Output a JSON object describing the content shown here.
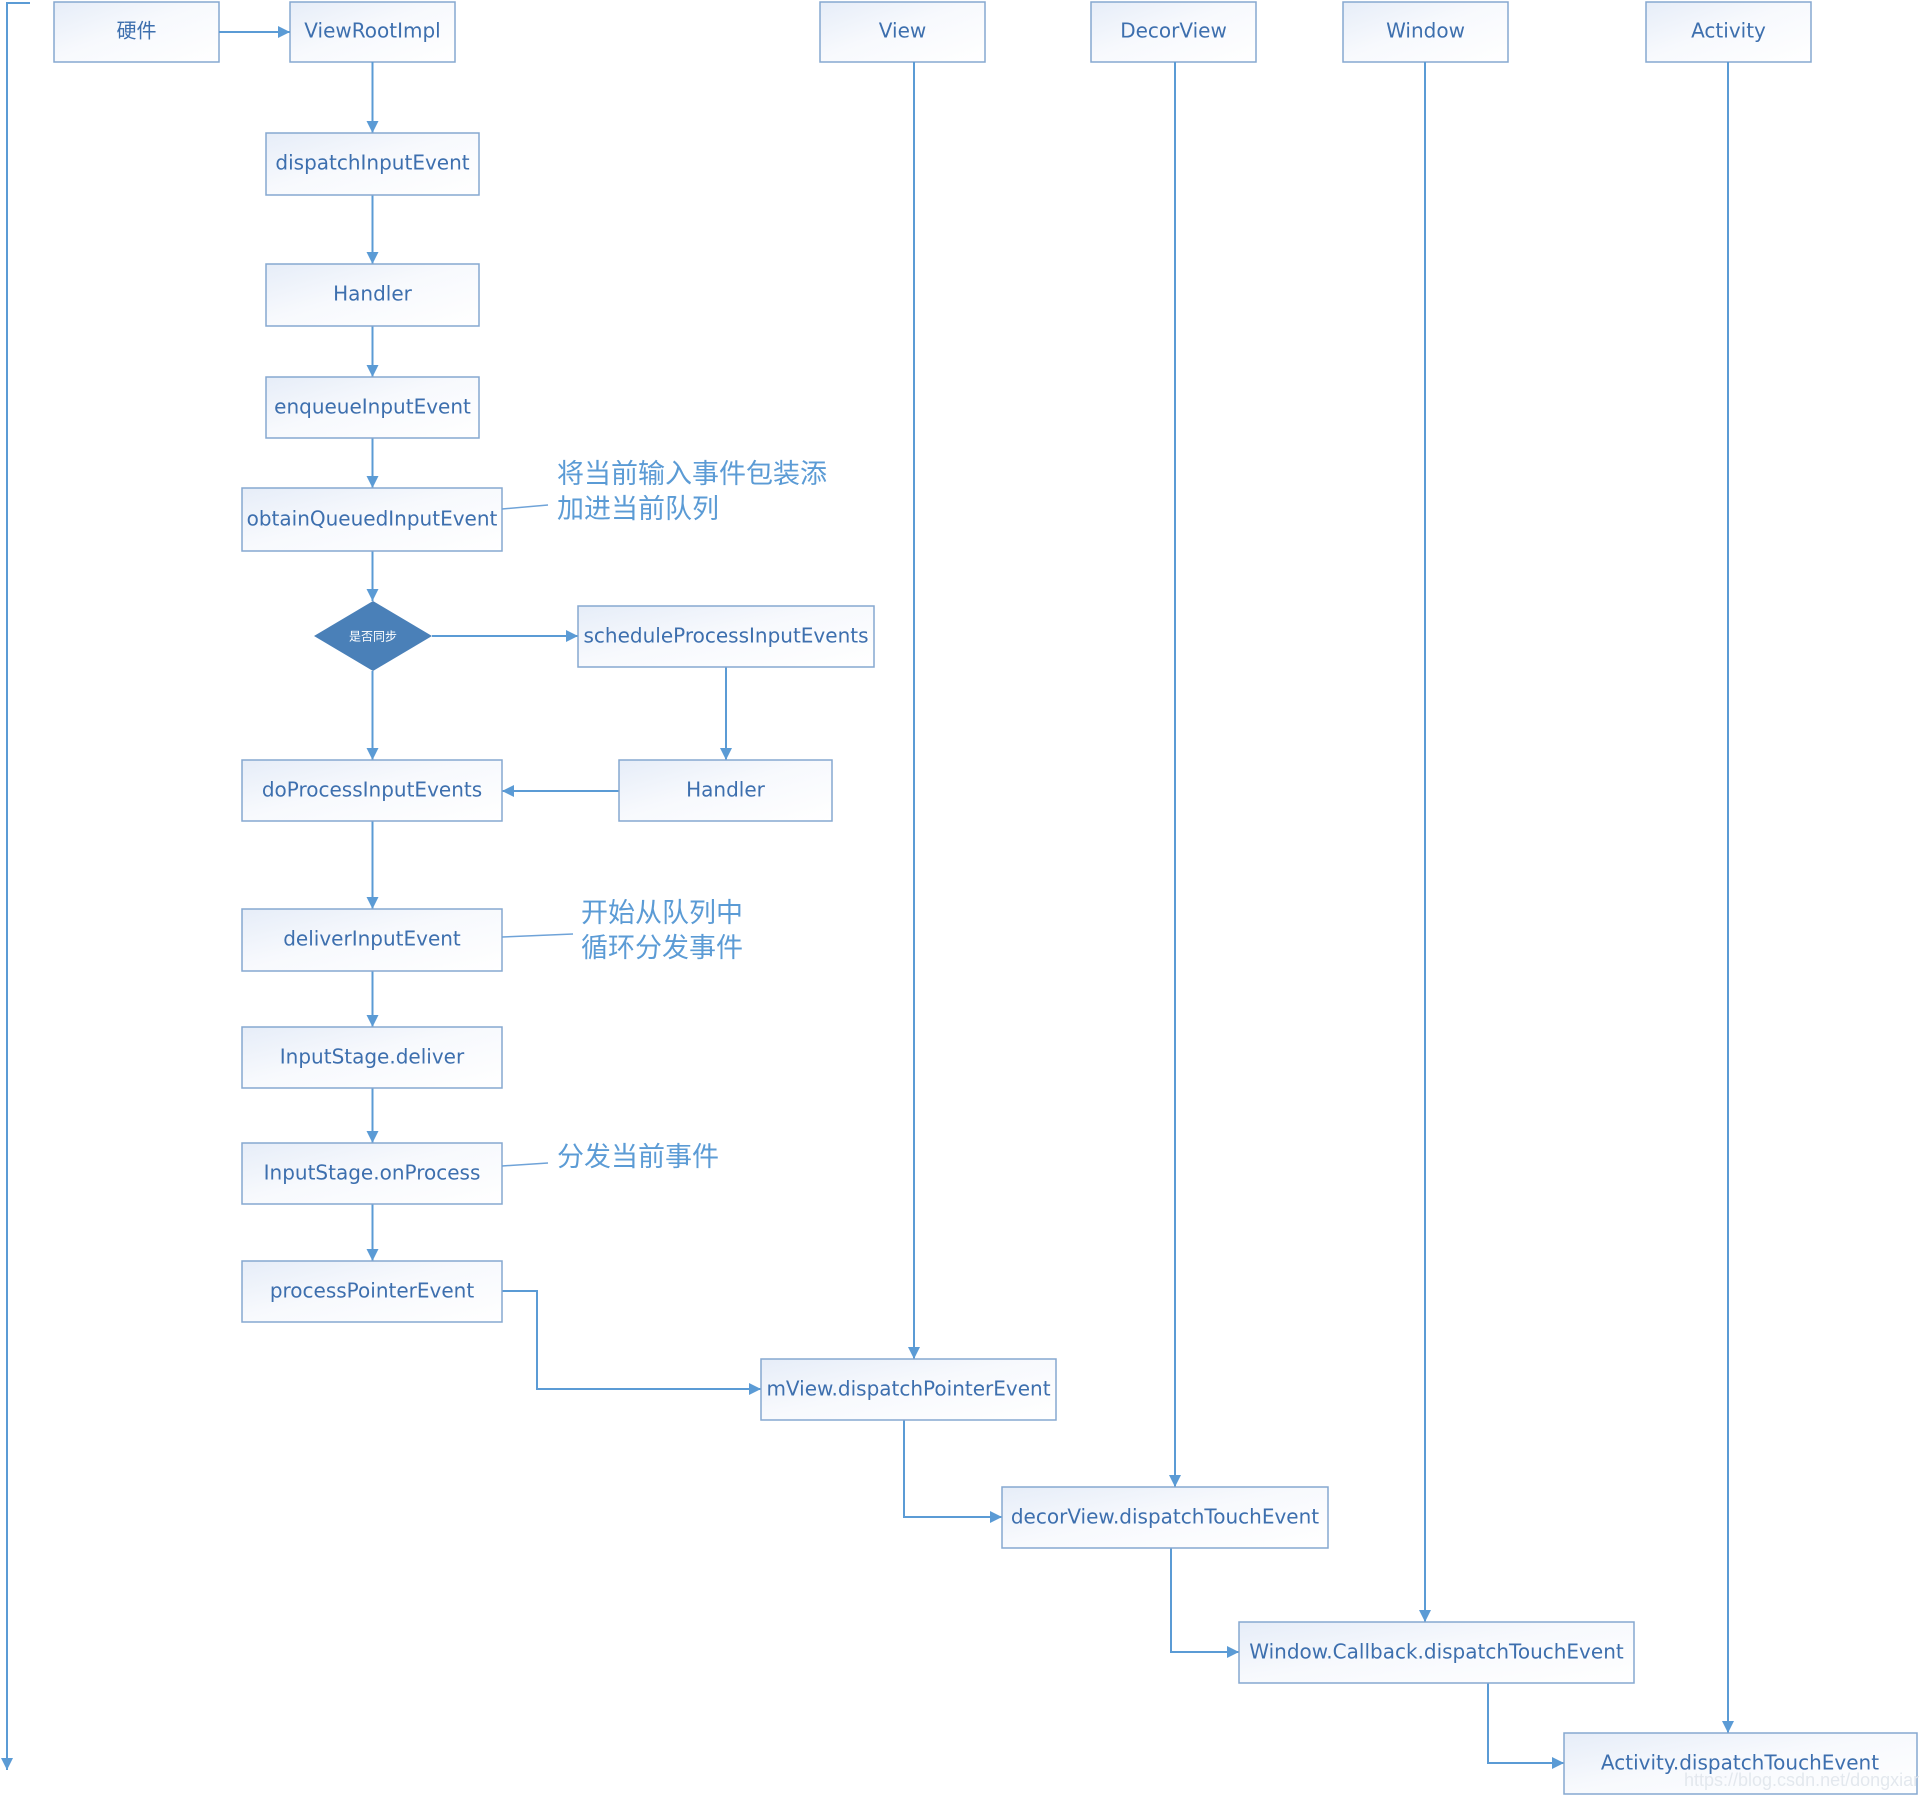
{
  "lanes": {
    "hardware": "硬件",
    "view_root_impl": "ViewRootImpl",
    "view": "View",
    "decor_view": "DecorView",
    "window": "Window",
    "activity": "Activity"
  },
  "steps": {
    "dispatch_input_event": "dispatchInputEvent",
    "handler_1": "Handler",
    "enqueue_input_event": "enqueueInputEvent",
    "obtain_queued_input_event": "obtainQueuedInputEvent",
    "is_sync_decision": "是否同步",
    "schedule_process_input_events": "scheduleProcessInputEvents",
    "handler_2": "Handler",
    "do_process_input_events": "doProcessInputEvents",
    "deliver_input_event": "deliverInputEvent",
    "input_stage_deliver": "InputStage.deliver",
    "input_stage_on_process": "InputStage.onProcess",
    "process_pointer_event": "processPointerEvent",
    "mview_dispatch_pointer_event": "mView.dispatchPointerEvent",
    "decorview_dispatch_touch_event": "decorView.dispatchTouchEvent",
    "window_callback_dispatch_touch_event": "Window.Callback.dispatchTouchEvent",
    "activity_dispatch_touch_event": "Activity.dispatchTouchEvent"
  },
  "notes": {
    "obtain_line1": "将当前输入事件包装添",
    "obtain_line2": "加进当前队列",
    "deliver_line1": "开始从队列中",
    "deliver_line2": "循环分发事件",
    "on_process": "分发当前事件"
  },
  "watermark": "https://blog.csdn.net/dongxianfei",
  "colors": {
    "box_border": "#86a8d0",
    "box_text": "#3d6fae",
    "connector": "#5b9bd5",
    "decision_fill": "#4a80b8",
    "note_text": "#5b9bd5"
  }
}
